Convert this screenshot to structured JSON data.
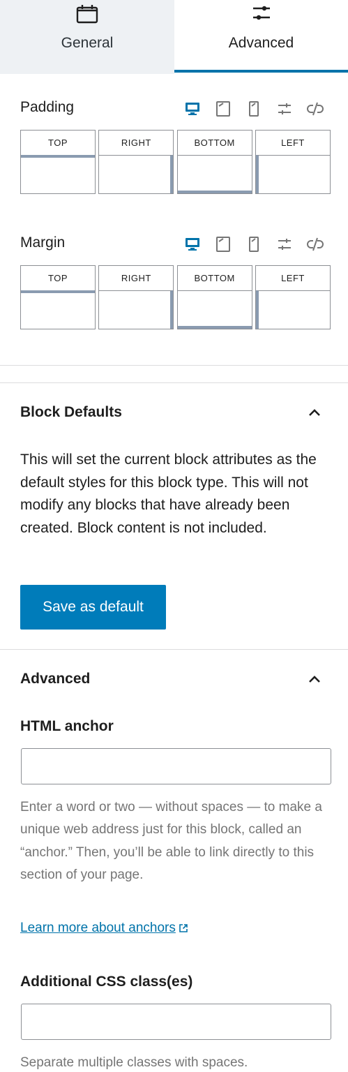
{
  "tabs": [
    {
      "label": "General",
      "icon": "window-icon"
    },
    {
      "label": "Advanced",
      "icon": "sliders-icon"
    }
  ],
  "padding": {
    "label": "Padding",
    "sides": [
      "TOP",
      "RIGHT",
      "BOTTOM",
      "LEFT"
    ]
  },
  "margin": {
    "label": "Margin",
    "sides": [
      "TOP",
      "RIGHT",
      "BOTTOM",
      "LEFT"
    ]
  },
  "block_defaults": {
    "title": "Block Defaults",
    "description": "This will set the current block attributes as the default styles for this block type. This will not modify any blocks that have already been created. Block content is not included.",
    "button_label": "Save as default"
  },
  "advanced": {
    "title": "Advanced",
    "anchor_label": "HTML anchor",
    "anchor_value": "",
    "anchor_help": "Enter a word or two — without spaces — to make a unique web address just for this block, called an “anchor.” Then, you’ll be able to link directly to this section of your page.",
    "anchor_link": "Learn more about anchors",
    "css_label": "Additional CSS class(es)",
    "css_value": "",
    "css_help": "Separate multiple classes with spaces."
  },
  "colors": {
    "accent": "#0073aa",
    "button": "#007cba",
    "device_active": "#0073aa",
    "muted": "#757575"
  }
}
